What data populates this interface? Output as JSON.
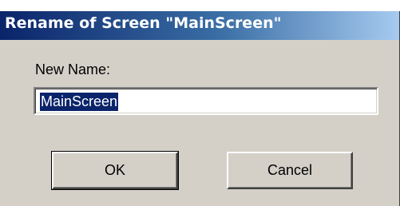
{
  "dialog": {
    "title": "Rename of Screen \"MainScreen\"",
    "label": "New Name:",
    "name_value": "MainScreen",
    "ok_label": "OK",
    "cancel_label": "Cancel"
  },
  "colors": {
    "titlebar_start": "#0a246a",
    "titlebar_end": "#a6caf0",
    "face": "#d4d0c8",
    "selection": "#0a246a"
  }
}
